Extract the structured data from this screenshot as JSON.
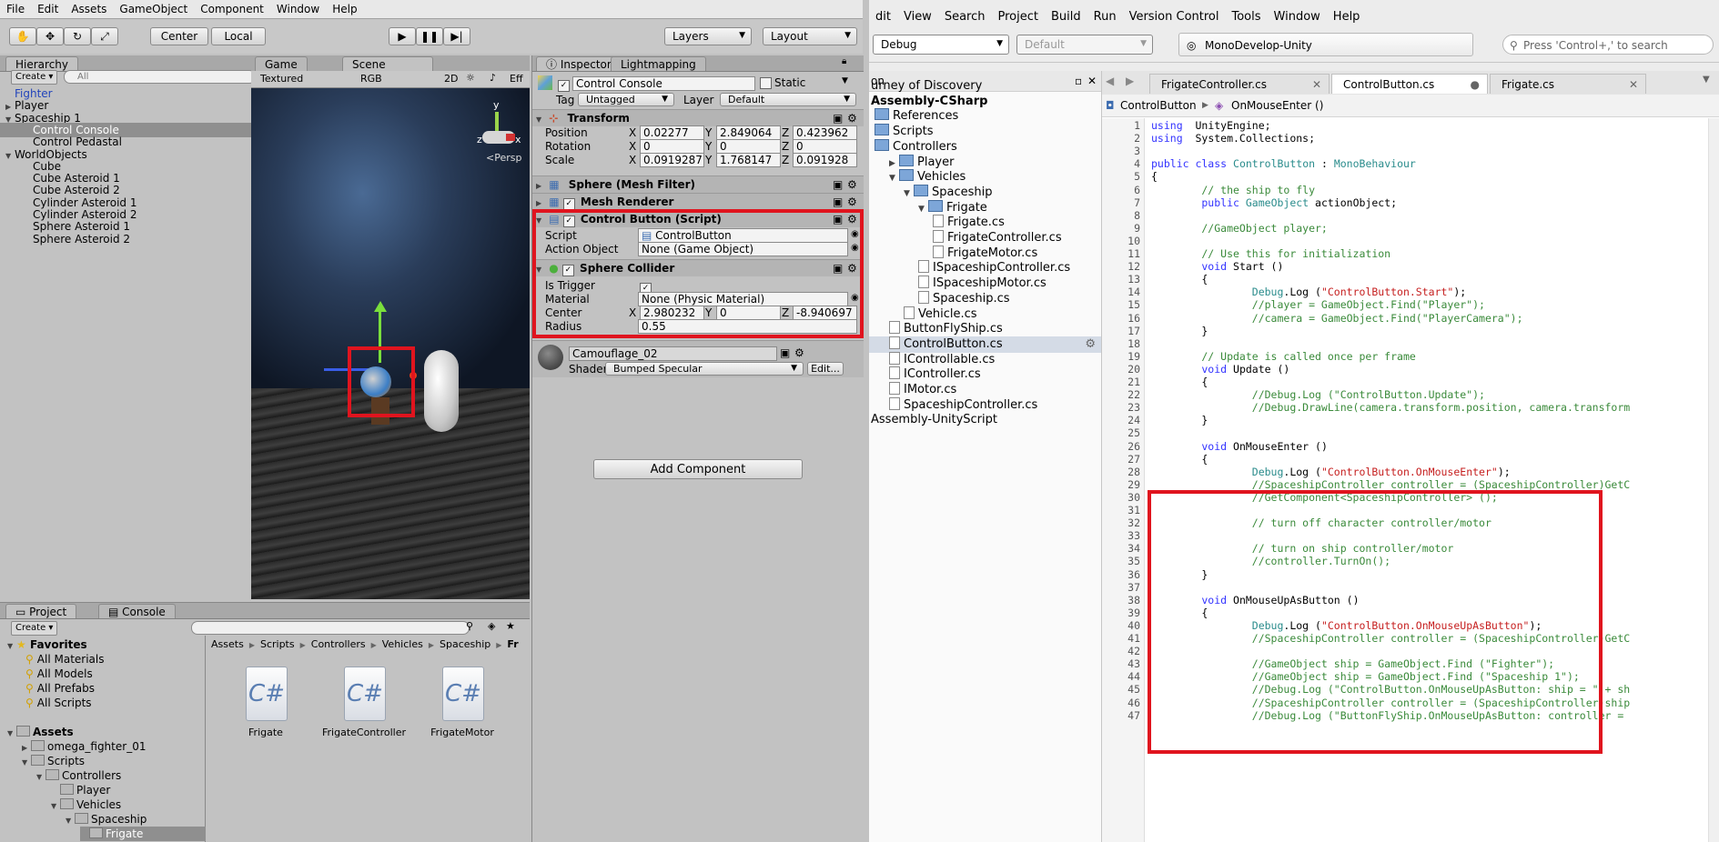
{
  "unity": {
    "menu": [
      "File",
      "Edit",
      "Assets",
      "GameObject",
      "Component",
      "Window",
      "Help"
    ],
    "toolbar": {
      "center_label": "Center",
      "local_label": "Local",
      "layers_label": "Layers",
      "layout_label": "Layout"
    },
    "hierarchy": {
      "tab": "Hierarchy",
      "create": "Create",
      "search_placeholder": "All",
      "items": [
        {
          "label": "Fighter",
          "indent": 0,
          "triangle": "",
          "color": "#2244bb"
        },
        {
          "label": "Player",
          "indent": 0,
          "triangle": "▶"
        },
        {
          "label": "Spaceship 1",
          "indent": 0,
          "triangle": "▼"
        },
        {
          "label": "Control Console",
          "indent": 1,
          "triangle": "",
          "selected": true
        },
        {
          "label": "Control Pedastal",
          "indent": 1,
          "triangle": ""
        },
        {
          "label": "WorldObjects",
          "indent": 0,
          "triangle": "▼"
        },
        {
          "label": "Cube",
          "indent": 1,
          "triangle": ""
        },
        {
          "label": "Cube Asteroid 1",
          "indent": 1,
          "triangle": ""
        },
        {
          "label": "Cube Asteroid 2",
          "indent": 1,
          "triangle": ""
        },
        {
          "label": "Cylinder Asteroid 1",
          "indent": 1,
          "triangle": ""
        },
        {
          "label": "Cylinder Asteroid 2",
          "indent": 1,
          "triangle": ""
        },
        {
          "label": "Sphere Asteroid 1",
          "indent": 1,
          "triangle": ""
        },
        {
          "label": "Sphere Asteroid 2",
          "indent": 1,
          "triangle": ""
        }
      ]
    },
    "scene": {
      "game_tab": "Game",
      "scene_tab": "Scene",
      "shading": "Textured",
      "render": "RGB",
      "mode2d": "2D",
      "effects": "Eff",
      "persp": "Persp",
      "axis_y": "y",
      "axis_x": "x",
      "axis_z": "z"
    },
    "inspector": {
      "tab": "Inspector",
      "lightmap_tab": "Lightmapping",
      "object_name": "Control Console",
      "static_label": "Static",
      "tag_label": "Tag",
      "tag_value": "Untagged",
      "layer_label": "Layer",
      "layer_value": "Default",
      "transform": {
        "title": "Transform",
        "rows": [
          {
            "label": "Position",
            "x": "0.02277",
            "y": "2.849064",
            "z": "0.423962"
          },
          {
            "label": "Rotation",
            "x": "0",
            "y": "0",
            "z": "0"
          },
          {
            "label": "Scale",
            "x": "0.0919287",
            "y": "1.768147",
            "z": "0.091928"
          }
        ]
      },
      "mesh_filter": "Sphere (Mesh Filter)",
      "mesh_renderer": "Mesh Renderer",
      "control_button": {
        "title": "Control Button (Script)",
        "script_label": "Script",
        "script_value": "ControlButton",
        "action_label": "Action Object",
        "action_value": "None (Game Object)"
      },
      "sphere_collider": {
        "title": "Sphere Collider",
        "trigger_label": "Is Trigger",
        "material_label": "Material",
        "material_value": "None (Physic Material)",
        "center_label": "Center",
        "cx": "2.980232",
        "cy": "0",
        "cz": "-8.940697",
        "radius_label": "Radius",
        "radius_value": "0.55"
      },
      "material": {
        "name": "Camouflage_02",
        "shader_label": "Shader",
        "shader_value": "Bumped Specular",
        "edit": "Edit..."
      },
      "add_component": "Add Component"
    },
    "project": {
      "tab": "Project",
      "console_tab": "Console",
      "create": "Create",
      "favorites_label": "Favorites",
      "favorites": [
        "All Materials",
        "All Models",
        "All Prefabs",
        "All Scripts"
      ],
      "assets_label": "Assets",
      "tree": [
        {
          "label": "omega_fighter_01",
          "indent": 1,
          "triangle": "▶"
        },
        {
          "label": "Scripts",
          "indent": 1,
          "triangle": "▼"
        },
        {
          "label": "Controllers",
          "indent": 2,
          "triangle": "▼"
        },
        {
          "label": "Player",
          "indent": 3,
          "triangle": ""
        },
        {
          "label": "Vehicles",
          "indent": 3,
          "triangle": "▼"
        },
        {
          "label": "Spaceship",
          "indent": 4,
          "triangle": "▼"
        },
        {
          "label": "Frigate",
          "indent": 5,
          "triangle": "",
          "selected": true
        }
      ],
      "breadcrumb": [
        "Assets",
        "Scripts",
        "Controllers",
        "Vehicles",
        "Spaceship",
        "Fr"
      ],
      "files": [
        "Frigate",
        "FrigateController",
        "FrigateMotor"
      ],
      "cs_glyph": "C#"
    }
  },
  "mono": {
    "menu": [
      "dit",
      "View",
      "Search",
      "Project",
      "Build",
      "Run",
      "Version Control",
      "Tools",
      "Window",
      "Help"
    ],
    "config": "Debug",
    "platform": "Default",
    "status": "MonoDevelop-Unity",
    "search_placeholder": "Press 'Control+,' to search",
    "solution": {
      "header": "on",
      "items": [
        {
          "label": "urney of Discovery",
          "indent": 0,
          "kind": "plain"
        },
        {
          "label": "Assembly-CSharp",
          "indent": 0,
          "kind": "bold"
        },
        {
          "label": "References",
          "indent": 0,
          "kind": "folder"
        },
        {
          "label": "Scripts",
          "indent": 0,
          "kind": "folder"
        },
        {
          "label": "Controllers",
          "indent": 0,
          "kind": "folder"
        },
        {
          "label": "Player",
          "indent": 1,
          "kind": "folder",
          "triangle": "▶"
        },
        {
          "label": "Vehicles",
          "indent": 1,
          "kind": "folder",
          "triangle": "▼"
        },
        {
          "label": "Spaceship",
          "indent": 2,
          "kind": "folder",
          "triangle": "▼"
        },
        {
          "label": "Frigate",
          "indent": 3,
          "kind": "folder",
          "triangle": "▼"
        },
        {
          "label": "Frigate.cs",
          "indent": 4,
          "kind": "file"
        },
        {
          "label": "FrigateController.cs",
          "indent": 4,
          "kind": "file"
        },
        {
          "label": "FrigateMotor.cs",
          "indent": 4,
          "kind": "file"
        },
        {
          "label": "ISpaceshipController.cs",
          "indent": 3,
          "kind": "file"
        },
        {
          "label": "ISpaceshipMotor.cs",
          "indent": 3,
          "kind": "file"
        },
        {
          "label": "Spaceship.cs",
          "indent": 3,
          "kind": "file"
        },
        {
          "label": "Vehicle.cs",
          "indent": 2,
          "kind": "file"
        },
        {
          "label": "ButtonFlyShip.cs",
          "indent": 1,
          "kind": "file"
        },
        {
          "label": "ControlButton.cs",
          "indent": 1,
          "kind": "file",
          "selected": true
        },
        {
          "label": "IControllable.cs",
          "indent": 1,
          "kind": "file"
        },
        {
          "label": "IController.cs",
          "indent": 1,
          "kind": "file"
        },
        {
          "label": "IMotor.cs",
          "indent": 1,
          "kind": "file"
        },
        {
          "label": "SpaceshipController.cs",
          "indent": 1,
          "kind": "file"
        },
        {
          "label": "Assembly-UnityScript",
          "indent": 0,
          "kind": "plain"
        }
      ]
    },
    "tabs": [
      "FrigateController.cs",
      "ControlButton.cs",
      "Frigate.cs"
    ],
    "breadcrumb_class": "ControlButton",
    "breadcrumb_method": "OnMouseEnter ()",
    "code": [
      [
        [
          "kw",
          "using"
        ],
        [
          "",
          "  UnityEngine;"
        ]
      ],
      [
        [
          "kw",
          "using"
        ],
        [
          "",
          "  System.Collections;"
        ]
      ],
      [],
      [
        [
          "kw",
          "public class"
        ],
        [
          "",
          " "
        ],
        [
          "ty",
          "ControlButton"
        ],
        [
          "",
          " : "
        ],
        [
          "ty",
          "MonoBehaviour"
        ]
      ],
      [
        [
          "",
          "{"
        ]
      ],
      [
        [
          "cm",
          "        // the ship to fly"
        ]
      ],
      [
        [
          "kw",
          "        public"
        ],
        [
          "",
          " "
        ],
        [
          "ty",
          "GameObject"
        ],
        [
          "",
          " actionObject;"
        ]
      ],
      [],
      [
        [
          "cm",
          "        //GameObject player;"
        ]
      ],
      [],
      [
        [
          "cm",
          "        // Use this for initialization"
        ]
      ],
      [
        [
          "kw",
          "        void"
        ],
        [
          "",
          " Start ()"
        ]
      ],
      [
        [
          "",
          "        {"
        ]
      ],
      [
        [
          "",
          "                "
        ],
        [
          "ty",
          "Debug"
        ],
        [
          "",
          ".Log ("
        ],
        [
          "st",
          "\"ControlButton.Start\""
        ],
        [
          "",
          ");"
        ]
      ],
      [
        [
          "cm",
          "                //player = GameObject.Find(\"Player\");"
        ]
      ],
      [
        [
          "cm",
          "                //camera = GameObject.Find(\"PlayerCamera\");"
        ]
      ],
      [
        [
          "",
          "        }"
        ]
      ],
      [],
      [
        [
          "cm",
          "        // Update is called once per frame"
        ]
      ],
      [
        [
          "kw",
          "        void"
        ],
        [
          "",
          " Update ()"
        ]
      ],
      [
        [
          "",
          "        {"
        ]
      ],
      [
        [
          "cm",
          "                //Debug.Log (\"ControlButton.Update\");"
        ]
      ],
      [
        [
          "cm",
          "                //Debug.DrawLine(camera.transform.position, camera.transform"
        ]
      ],
      [
        [
          "",
          "        }"
        ]
      ],
      [],
      [
        [
          "kw",
          "        void"
        ],
        [
          "",
          " OnMouseEnter ()"
        ]
      ],
      [
        [
          "",
          "        {"
        ]
      ],
      [
        [
          "",
          "                "
        ],
        [
          "ty",
          "Debug"
        ],
        [
          "",
          ".Log ("
        ],
        [
          "st",
          "\"ControlButton.OnMouseEnter\""
        ],
        [
          "",
          ");"
        ]
      ],
      [
        [
          "cm",
          "                //SpaceshipController controller = (SpaceshipController)GetC"
        ]
      ],
      [
        [
          "cm",
          "                //GetComponent<SpaceshipController> ();"
        ]
      ],
      [],
      [
        [
          "cm",
          "                // turn off character controller/motor"
        ]
      ],
      [],
      [
        [
          "cm",
          "                // turn on ship controller/motor"
        ]
      ],
      [
        [
          "cm",
          "                //controller.TurnOn();"
        ]
      ],
      [
        [
          "",
          "        }"
        ]
      ],
      [],
      [
        [
          "kw",
          "        void"
        ],
        [
          "",
          " OnMouseUpAsButton ()"
        ]
      ],
      [
        [
          "",
          "        {"
        ]
      ],
      [
        [
          "",
          "                "
        ],
        [
          "ty",
          "Debug"
        ],
        [
          "",
          ".Log ("
        ],
        [
          "st",
          "\"ControlButton.OnMouseUpAsButton\""
        ],
        [
          "",
          ");"
        ]
      ],
      [
        [
          "cm",
          "                //SpaceshipController controller = (SpaceshipController)GetC"
        ]
      ],
      [],
      [
        [
          "cm",
          "                //GameObject ship = GameObject.Find (\"Fighter\");"
        ]
      ],
      [
        [
          "cm",
          "                //GameObject ship = GameObject.Find (\"Spaceship 1\");"
        ]
      ],
      [
        [
          "cm",
          "                //Debug.Log (\"ControlButton.OnMouseUpAsButton: ship = \" + sh"
        ]
      ],
      [
        [
          "cm",
          "                //SpaceshipController controller = (SpaceshipController)ship"
        ]
      ],
      [
        [
          "cm",
          "                //Debug.Log (\"ButtonFlyShip.OnMouseUpAsButton: controller = "
        ]
      ]
    ]
  },
  "colors": {
    "highlight_red": "#e0141e",
    "keyword": "#3333ff",
    "type": "#2a8c8c",
    "comment": "#3a8a3a",
    "string": "#c62020"
  }
}
